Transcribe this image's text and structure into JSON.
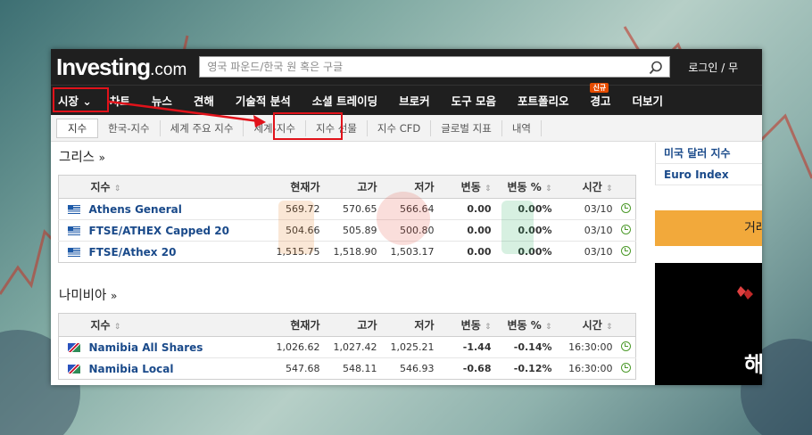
{
  "header": {
    "logo_main": "Investing",
    "logo_suffix": ".com",
    "search_placeholder": "영국 파운드/한국 원 혹은 구글",
    "login_label": "로그인 / 무"
  },
  "main_nav": [
    {
      "label": "시장 ⌄"
    },
    {
      "label": "차트"
    },
    {
      "label": "뉴스"
    },
    {
      "label": "견해"
    },
    {
      "label": "기술적 분석"
    },
    {
      "label": "소셜 트레이딩"
    },
    {
      "label": "브로커"
    },
    {
      "label": "도구 모음"
    },
    {
      "label": "포트폴리오"
    },
    {
      "label": "경고",
      "badge": "신규"
    },
    {
      "label": "더보기"
    }
  ],
  "sub_nav": [
    "지수",
    "한국-지수",
    "세계 주요 지수",
    "세계-지수",
    "지수 선물",
    "지수 CFD",
    "글로벌 지표",
    "내역"
  ],
  "columns": {
    "name": "지수",
    "last": "현재가",
    "high": "고가",
    "low": "저가",
    "change": "변동",
    "change_pct": "변동 %",
    "time": "시간",
    "sort_glyph": "⇕"
  },
  "sections": [
    {
      "title": "그리스",
      "raquo": "»",
      "flag": "greece-flag",
      "rows": [
        {
          "name": "Athens General",
          "last": "569.72",
          "high": "570.65",
          "low": "566.64",
          "change": "0.00",
          "change_pct": "0.00%",
          "time": "03/10"
        },
        {
          "name": "FTSE/ATHEX Capped 20",
          "last": "504.66",
          "high": "505.89",
          "low": "500.80",
          "change": "0.00",
          "change_pct": "0.00%",
          "time": "03/10"
        },
        {
          "name": "FTSE/Athex 20",
          "last": "1,515.75",
          "high": "1,518.90",
          "low": "1,503.17",
          "change": "0.00",
          "change_pct": "0.00%",
          "time": "03/10"
        }
      ]
    },
    {
      "title": "나미비아",
      "raquo": "»",
      "flag": "namibia-flag",
      "rows": [
        {
          "name": "Namibia All Shares",
          "last": "1,026.62",
          "high": "1,027.42",
          "low": "1,025.21",
          "change": "-1.44",
          "change_pct": "-0.14%",
          "time": "16:30:00"
        },
        {
          "name": "Namibia Local",
          "last": "547.68",
          "high": "548.11",
          "low": "546.93",
          "change": "-0.68",
          "change_pct": "-0.12%",
          "time": "16:30:00"
        }
      ]
    }
  ],
  "right_column": {
    "links": [
      "미국 달러 지수",
      "Euro Index"
    ],
    "orange_button": "거래",
    "ad_text": "해"
  },
  "colors": {
    "header_bg": "#1f1f1f",
    "link_blue": "#1a4a8a",
    "negative": "#1a8fb5",
    "highlight_red": "#e1121a",
    "orange": "#f2a93b"
  }
}
